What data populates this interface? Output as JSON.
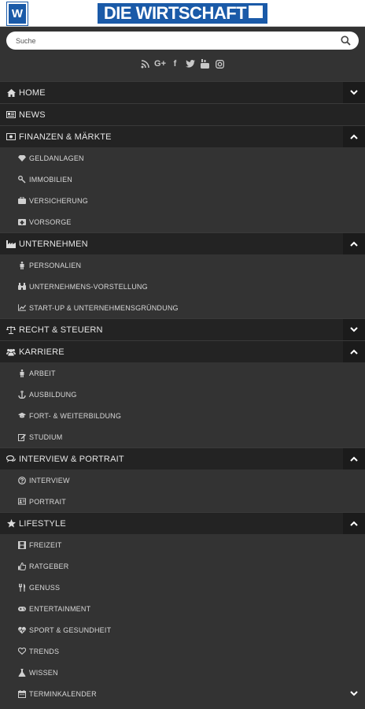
{
  "header": {
    "brand": "DIE WIRTSCHAFT",
    "logo_letter": "W"
  },
  "search": {
    "placeholder": "Suche"
  },
  "social": [
    "rss-icon",
    "google-plus-icon",
    "facebook-icon",
    "twitter-icon",
    "youtube-icon",
    "instagram-icon"
  ],
  "menu": {
    "home": "HOME",
    "news": "NEWS",
    "finanzen": "FINANZEN & MÄRKTE",
    "finanzen_items": [
      "GELDANLAGEN",
      "IMMOBILIEN",
      "VERSICHERUNG",
      "VORSORGE"
    ],
    "unternehmen": "UNTERNEHMEN",
    "unternehmen_items": [
      "PERSONALIEN",
      "UNTERNEHMENS-VORSTELLUNG",
      "START-UP & UNTERNEHMENSGRÜNDUNG"
    ],
    "recht": "RECHT & STEUERN",
    "karriere": "KARRIERE",
    "karriere_items": [
      "ARBEIT",
      "AUSBILDUNG",
      "FORT- & WEITERBILDUNG",
      "STUDIUM"
    ],
    "interview": "INTERVIEW & PORTRAIT",
    "interview_items": [
      "INTERVIEW",
      "PORTRAIT"
    ],
    "lifestyle": "LIFESTYLE",
    "lifestyle_items": [
      "FREIZEIT",
      "RATGEBER",
      "GENUSS",
      "ENTERTAINMENT",
      "SPORT & GESUNDHEIT",
      "TRENDS",
      "WISSEN",
      "TERMINKALENDER"
    ]
  },
  "colors": {
    "brand_blue": "#1a5aa8",
    "menu_top": "#232323",
    "menu_sub": "#333333",
    "toggle": "#1b1b1b"
  }
}
